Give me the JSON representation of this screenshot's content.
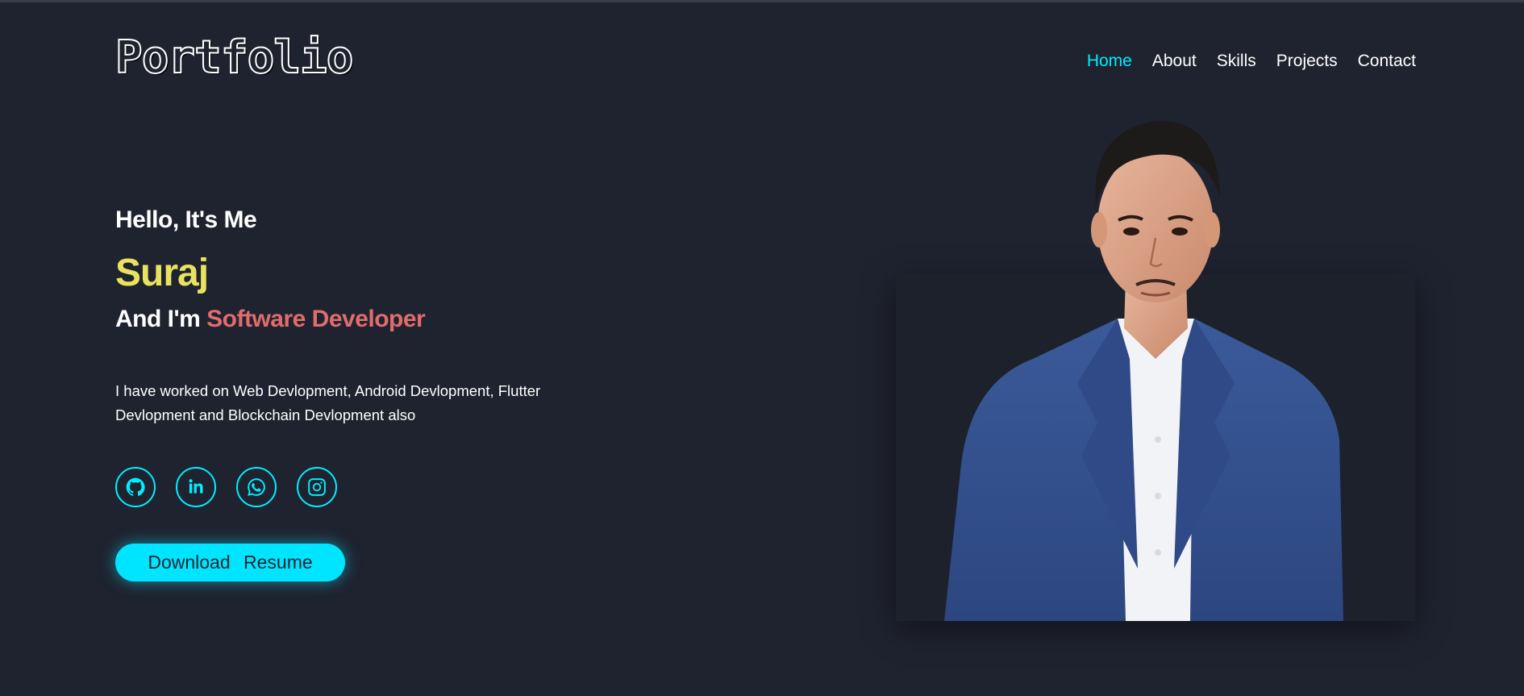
{
  "header": {
    "logo": "Portfolio",
    "nav": [
      {
        "label": "Home",
        "active": true
      },
      {
        "label": "About",
        "active": false
      },
      {
        "label": "Skills",
        "active": false
      },
      {
        "label": "Projects",
        "active": false
      },
      {
        "label": "Contact",
        "active": false
      }
    ]
  },
  "hero": {
    "greeting": "Hello, It's Me",
    "name": "Suraj",
    "role_prefix": "And I'm",
    "role": "Software Developer",
    "description": "I have worked on Web Devlopment, Android Devlopment, Flutter Devlopment and Blockchain Devlopment also",
    "socials": [
      {
        "icon": "github-icon"
      },
      {
        "icon": "linkedin-icon"
      },
      {
        "icon": "whatsapp-icon"
      },
      {
        "icon": "instagram-icon"
      }
    ],
    "button_label": "Download Resume"
  },
  "colors": {
    "background": "#1f2330",
    "accent": "#00eeff",
    "name": "#e8e35f",
    "role": "#e06c6c"
  }
}
